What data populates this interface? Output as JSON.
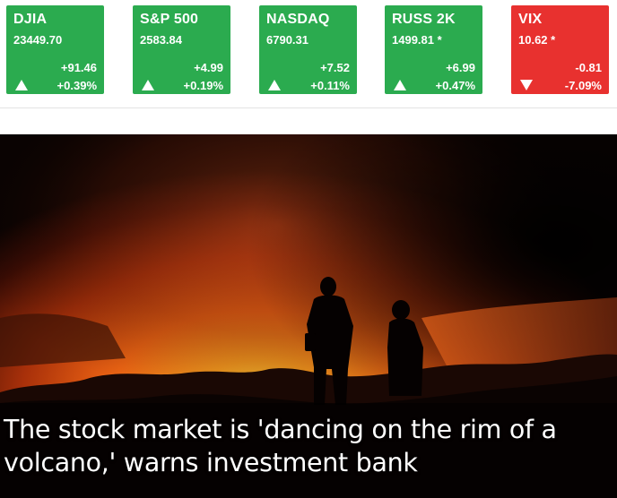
{
  "tickers": [
    {
      "symbol": "DJIA",
      "price": "23449.70",
      "change": "+91.46",
      "percent": "+0.39%",
      "direction": "up"
    },
    {
      "symbol": "S&P 500",
      "price": "2583.84",
      "change": "+4.99",
      "percent": "+0.19%",
      "direction": "up"
    },
    {
      "symbol": "NASDAQ",
      "price": "6790.31",
      "change": "+7.52",
      "percent": "+0.11%",
      "direction": "up"
    },
    {
      "symbol": "RUSS 2K",
      "price": "1499.81 *",
      "change": "+6.99",
      "percent": "+0.47%",
      "direction": "up"
    },
    {
      "symbol": "VIX",
      "price": "10.62 *",
      "change": "-0.81",
      "percent": "-7.09%",
      "direction": "down"
    }
  ],
  "colors": {
    "up": "#2bab4f",
    "down": "#e8312f"
  },
  "icons": {
    "up": "triangle-up-icon",
    "down": "triangle-down-icon"
  },
  "hero": {
    "headline": "The stock market is 'dancing on the rim of a volcano,' warns investment bank"
  }
}
